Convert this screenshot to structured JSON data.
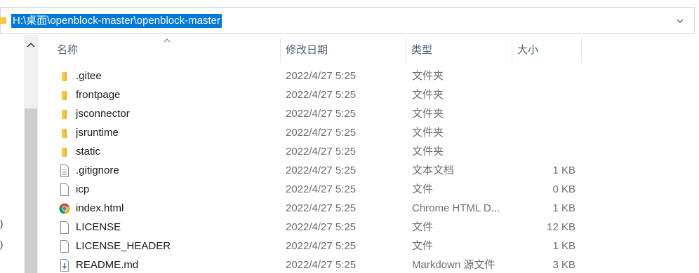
{
  "address": {
    "path": "H:\\桌面\\openblock-master\\openblock-master"
  },
  "nav": {
    "truncated_items": [
      ")",
      ")"
    ]
  },
  "columns": {
    "name": "名称",
    "date": "修改日期",
    "type": "类型",
    "size": "大小"
  },
  "files": [
    {
      "name": ".gitee",
      "date": "2022/4/27 5:25",
      "type": "文件夹",
      "size": "",
      "icon": "folder-icon"
    },
    {
      "name": "frontpage",
      "date": "2022/4/27 5:25",
      "type": "文件夹",
      "size": "",
      "icon": "folder-icon"
    },
    {
      "name": "jsconnector",
      "date": "2022/4/27 5:25",
      "type": "文件夹",
      "size": "",
      "icon": "folder-icon"
    },
    {
      "name": "jsruntime",
      "date": "2022/4/27 5:25",
      "type": "文件夹",
      "size": "",
      "icon": "folder-icon"
    },
    {
      "name": "static",
      "date": "2022/4/27 5:25",
      "type": "文件夹",
      "size": "",
      "icon": "folder-icon"
    },
    {
      "name": ".gitignore",
      "date": "2022/4/27 5:25",
      "type": "文本文档",
      "size": "1 KB",
      "icon": "text-document-icon"
    },
    {
      "name": "icp",
      "date": "2022/4/27 5:25",
      "type": "文件",
      "size": "0 KB",
      "icon": "file-icon"
    },
    {
      "name": "index.html",
      "date": "2022/4/27 5:25",
      "type": "Chrome HTML D...",
      "size": "1 KB",
      "icon": "chrome-icon"
    },
    {
      "name": "LICENSE",
      "date": "2022/4/27 5:25",
      "type": "文件",
      "size": "12 KB",
      "icon": "file-icon"
    },
    {
      "name": "LICENSE_HEADER",
      "date": "2022/4/27 5:25",
      "type": "文件",
      "size": "1 KB",
      "icon": "file-icon"
    },
    {
      "name": "README.md",
      "date": "2022/4/27 5:25",
      "type": "Markdown 源文件",
      "size": "3 KB",
      "icon": "markdown-file-icon"
    }
  ],
  "colors": {
    "selection": "#0078d7",
    "folder": "#f8c944",
    "header_text": "#4c607a"
  }
}
